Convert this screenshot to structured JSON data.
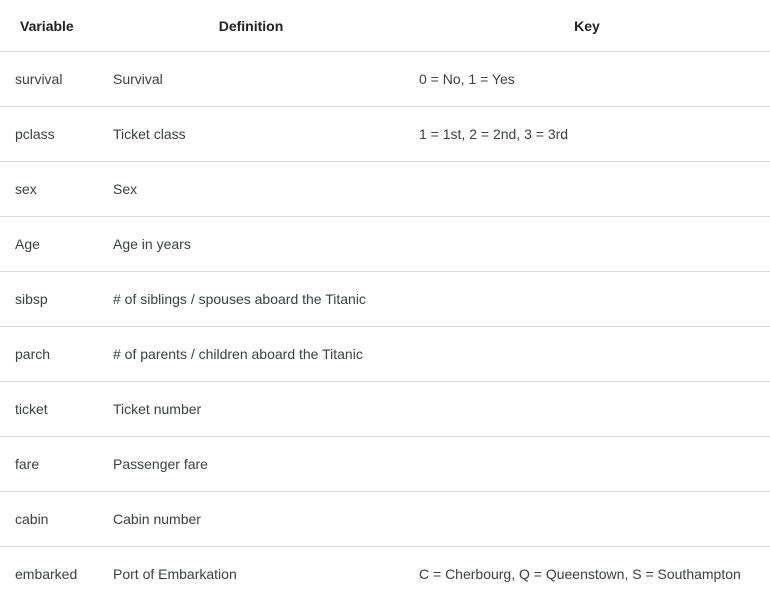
{
  "table": {
    "headers": {
      "variable": "Variable",
      "definition": "Definition",
      "key": "Key"
    },
    "rows": [
      {
        "variable": "survival",
        "definition": "Survival",
        "key": "0 = No, 1 = Yes"
      },
      {
        "variable": "pclass",
        "definition": "Ticket class",
        "key": "1 = 1st, 2 = 2nd, 3 = 3rd"
      },
      {
        "variable": "sex",
        "definition": "Sex",
        "key": ""
      },
      {
        "variable": "Age",
        "definition": "Age in years",
        "key": ""
      },
      {
        "variable": "sibsp",
        "definition": "# of siblings / spouses aboard the Titanic",
        "key": ""
      },
      {
        "variable": "parch",
        "definition": "# of parents / children aboard the Titanic",
        "key": ""
      },
      {
        "variable": "ticket",
        "definition": "Ticket number",
        "key": ""
      },
      {
        "variable": "fare",
        "definition": "Passenger fare",
        "key": ""
      },
      {
        "variable": "cabin",
        "definition": "Cabin number",
        "key": ""
      },
      {
        "variable": "embarked",
        "definition": "Port of Embarkation",
        "key": "C = Cherbourg, Q = Queenstown, S = Southampton"
      }
    ]
  }
}
